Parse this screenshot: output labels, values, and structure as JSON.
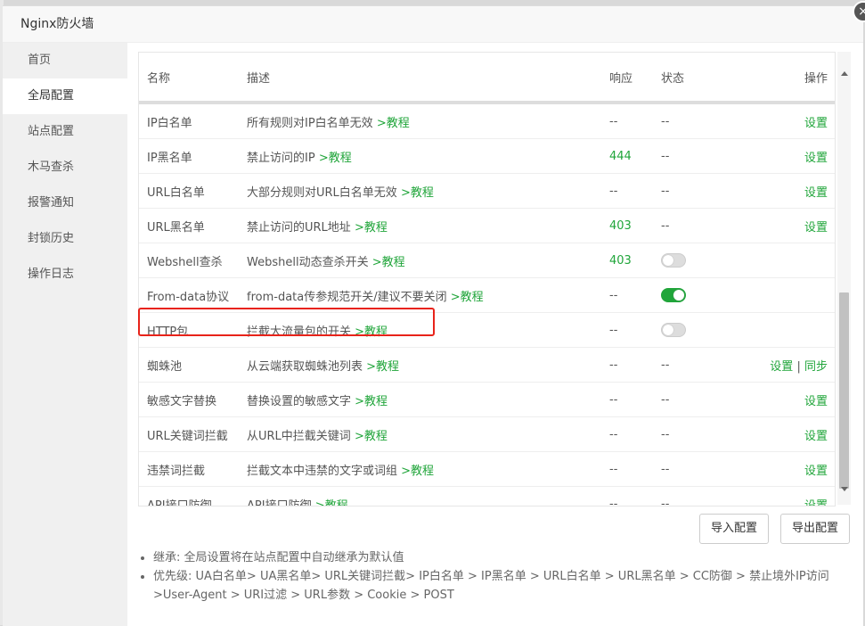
{
  "dialog": {
    "title": "Nginx防火墙",
    "close": "×"
  },
  "sidebar": {
    "items": [
      {
        "label": "首页"
      },
      {
        "label": "全局配置"
      },
      {
        "label": "站点配置"
      },
      {
        "label": "木马查杀"
      },
      {
        "label": "报警通知"
      },
      {
        "label": "封锁历史"
      },
      {
        "label": "操作日志"
      }
    ]
  },
  "table": {
    "headers": [
      "名称",
      "描述",
      "响应",
      "状态",
      "操作"
    ],
    "rows": [
      {
        "name": "IP白名单",
        "desc": "所有规则对IP白名单无效",
        "link": ">教程",
        "resp": "--",
        "status": "--",
        "action": "设置"
      },
      {
        "name": "IP黑名单",
        "desc": "禁止访问的IP",
        "link": ">教程",
        "resp": "444",
        "status": "--",
        "action": "设置"
      },
      {
        "name": "URL白名单",
        "desc": "大部分规则对URL白名单无效",
        "link": ">教程",
        "resp": "--",
        "status": "--",
        "action": "设置"
      },
      {
        "name": "URL黑名单",
        "desc": "禁止访问的URL地址",
        "link": ">教程",
        "resp": "403",
        "status": "--",
        "action": "设置"
      },
      {
        "name": "Webshell查杀",
        "desc": "Webshell动态查杀开关",
        "link": ">教程",
        "resp": "403",
        "status": "off",
        "action": ""
      },
      {
        "name": "From-data协议",
        "desc": "from-data传参规范开关/建议不要关闭",
        "link": ">教程",
        "resp": "--",
        "status": "on",
        "action": ""
      },
      {
        "name": "HTTP包",
        "desc": "拦截大流量包的开关",
        "link": ">教程",
        "resp": "--",
        "status": "off",
        "action": ""
      },
      {
        "name": "蜘蛛池",
        "desc": "从云端获取蜘蛛池列表",
        "link": ">教程",
        "resp": "--",
        "status": "--",
        "action": "设置",
        "action2": "同步",
        "sep": "|"
      },
      {
        "name": "敏感文字替换",
        "desc": "替换设置的敏感文字",
        "link": ">教程",
        "resp": "--",
        "status": "--",
        "action": "设置"
      },
      {
        "name": "URL关键词拦截",
        "desc": "从URL中拦截关键词",
        "link": ">教程",
        "resp": "--",
        "status": "--",
        "action": "设置"
      },
      {
        "name": "违禁词拦截",
        "desc": "拦截文本中违禁的文字或词组",
        "link": ">教程",
        "resp": "--",
        "status": "--",
        "action": "设置"
      },
      {
        "name": "API接口防御",
        "desc": "API接口防御",
        "link": ">教程",
        "resp": "--",
        "status": "--",
        "action": "设置"
      }
    ]
  },
  "buttons": {
    "import": "导入配置",
    "export": "导出配置"
  },
  "notes": {
    "line1": "继承: 全局设置将在站点配置中自动继承为默认值",
    "line2a": "优先级: UA白名单> UA黑名单> URL关键词拦截> IP白名单 > IP黑名单 > URL白名单 > URL黑名单 > CC防御 > 禁止境外IP访问",
    "line2b": ">User-Agent > URI过滤 > URL参数 > Cookie > POST"
  },
  "colors": {
    "accent": "#20a53a",
    "highlight": "#e8231a"
  }
}
